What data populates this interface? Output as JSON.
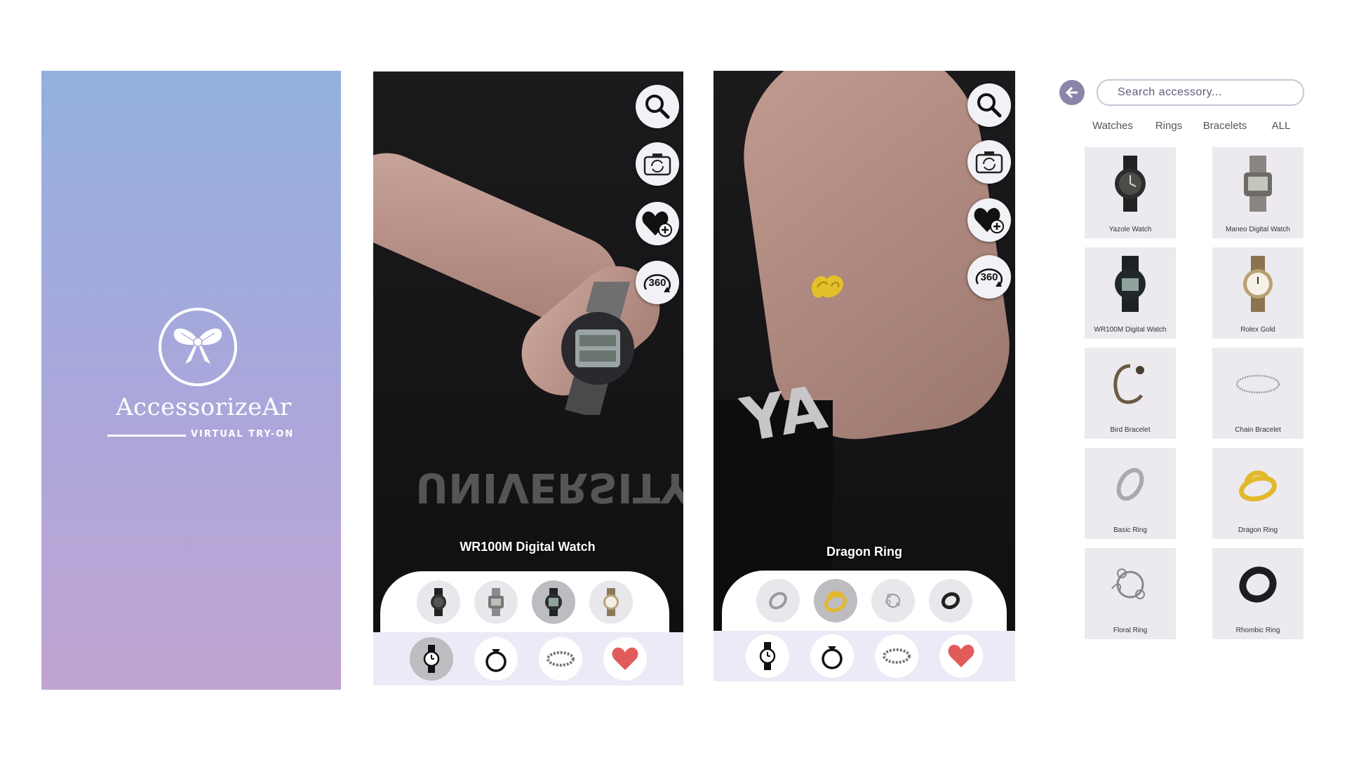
{
  "splash": {
    "brand_name": "AccessorizeAr",
    "tagline": "VIRTUAL TRY-ON"
  },
  "screen_watch": {
    "item_title": "WR100M Digital Watch",
    "shirt_text": "UNIVERSITY",
    "side_buttons": [
      "search-icon",
      "camera-flip-icon",
      "heart-add-icon",
      "rotate-360-icon"
    ],
    "side_button_360_label": "360",
    "carousel_items": [
      "Yazole Watch",
      "Maneo Digital Watch",
      "WR100M Digital Watch",
      "Rolex Gold"
    ],
    "selected_carousel_index": 2,
    "category_tabs": [
      "watch-icon",
      "ring-icon",
      "bracelet-icon",
      "heart-icon"
    ],
    "selected_tab_index": 0
  },
  "screen_ring": {
    "item_title": "Dragon Ring",
    "shirt_text": "YA",
    "side_buttons": [
      "search-icon",
      "camera-flip-icon",
      "heart-add-icon",
      "rotate-360-icon"
    ],
    "side_button_360_label": "360",
    "carousel_items": [
      "Basic Ring",
      "Dragon Ring",
      "Floral Ring",
      "Rhombic Ring"
    ],
    "selected_carousel_index": 1,
    "category_tabs": [
      "watch-icon",
      "ring-icon",
      "bracelet-icon",
      "heart-icon"
    ],
    "selected_tab_index": -1
  },
  "catalog": {
    "search_placeholder": "Search accessory...",
    "tabs": [
      "Watches",
      "Rings",
      "Bracelets",
      "ALL"
    ],
    "items": [
      {
        "label": "Yazole Watch",
        "icon": "watch-icon"
      },
      {
        "label": "Maneo Digital Watch",
        "icon": "digital-watch-icon"
      },
      {
        "label": "WR100M Digital Watch",
        "icon": "digital-watch-icon"
      },
      {
        "label": "Rolex Gold",
        "icon": "gold-watch-icon"
      },
      {
        "label": "Bird Bracelet",
        "icon": "bracelet-icon"
      },
      {
        "label": "Chain Bracelet",
        "icon": "chain-bracelet-icon"
      },
      {
        "label": "Basic Ring",
        "icon": "ring-icon"
      },
      {
        "label": "Dragon Ring",
        "icon": "gold-ring-icon"
      },
      {
        "label": "Floral Ring",
        "icon": "floral-ring-icon"
      },
      {
        "label": "Rhombic Ring",
        "icon": "black-ring-icon"
      }
    ]
  },
  "colors": {
    "splash_top": "#93b0dd",
    "splash_bottom": "#c0a4d2",
    "accent": "#8b86a8",
    "heart": "#e25b5b",
    "gold": "#e2b92b"
  }
}
